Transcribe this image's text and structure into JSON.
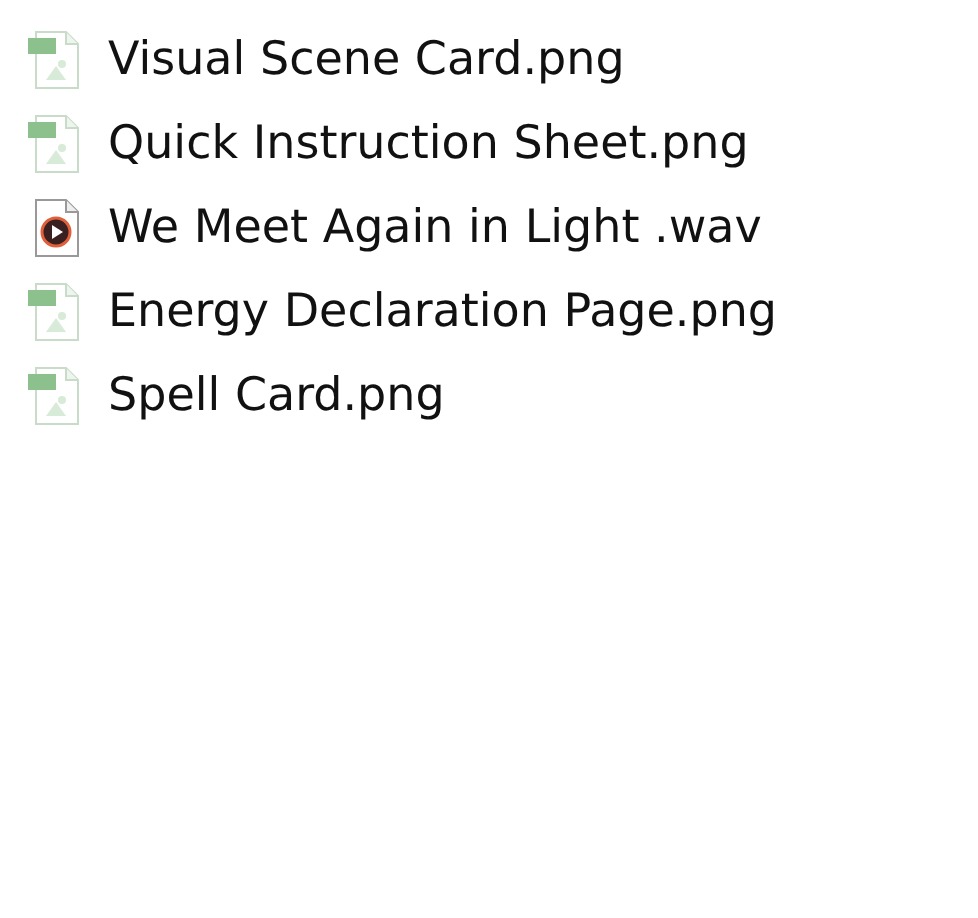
{
  "files": [
    {
      "name": "Visual Scene Card.png",
      "kind": "image"
    },
    {
      "name": "Quick Instruction Sheet.png",
      "kind": "image"
    },
    {
      "name": "We Meet Again in Light .wav",
      "kind": "audio"
    },
    {
      "name": "Energy Declaration Page.png",
      "kind": "image"
    },
    {
      "name": "Spell Card.png",
      "kind": "image"
    }
  ]
}
